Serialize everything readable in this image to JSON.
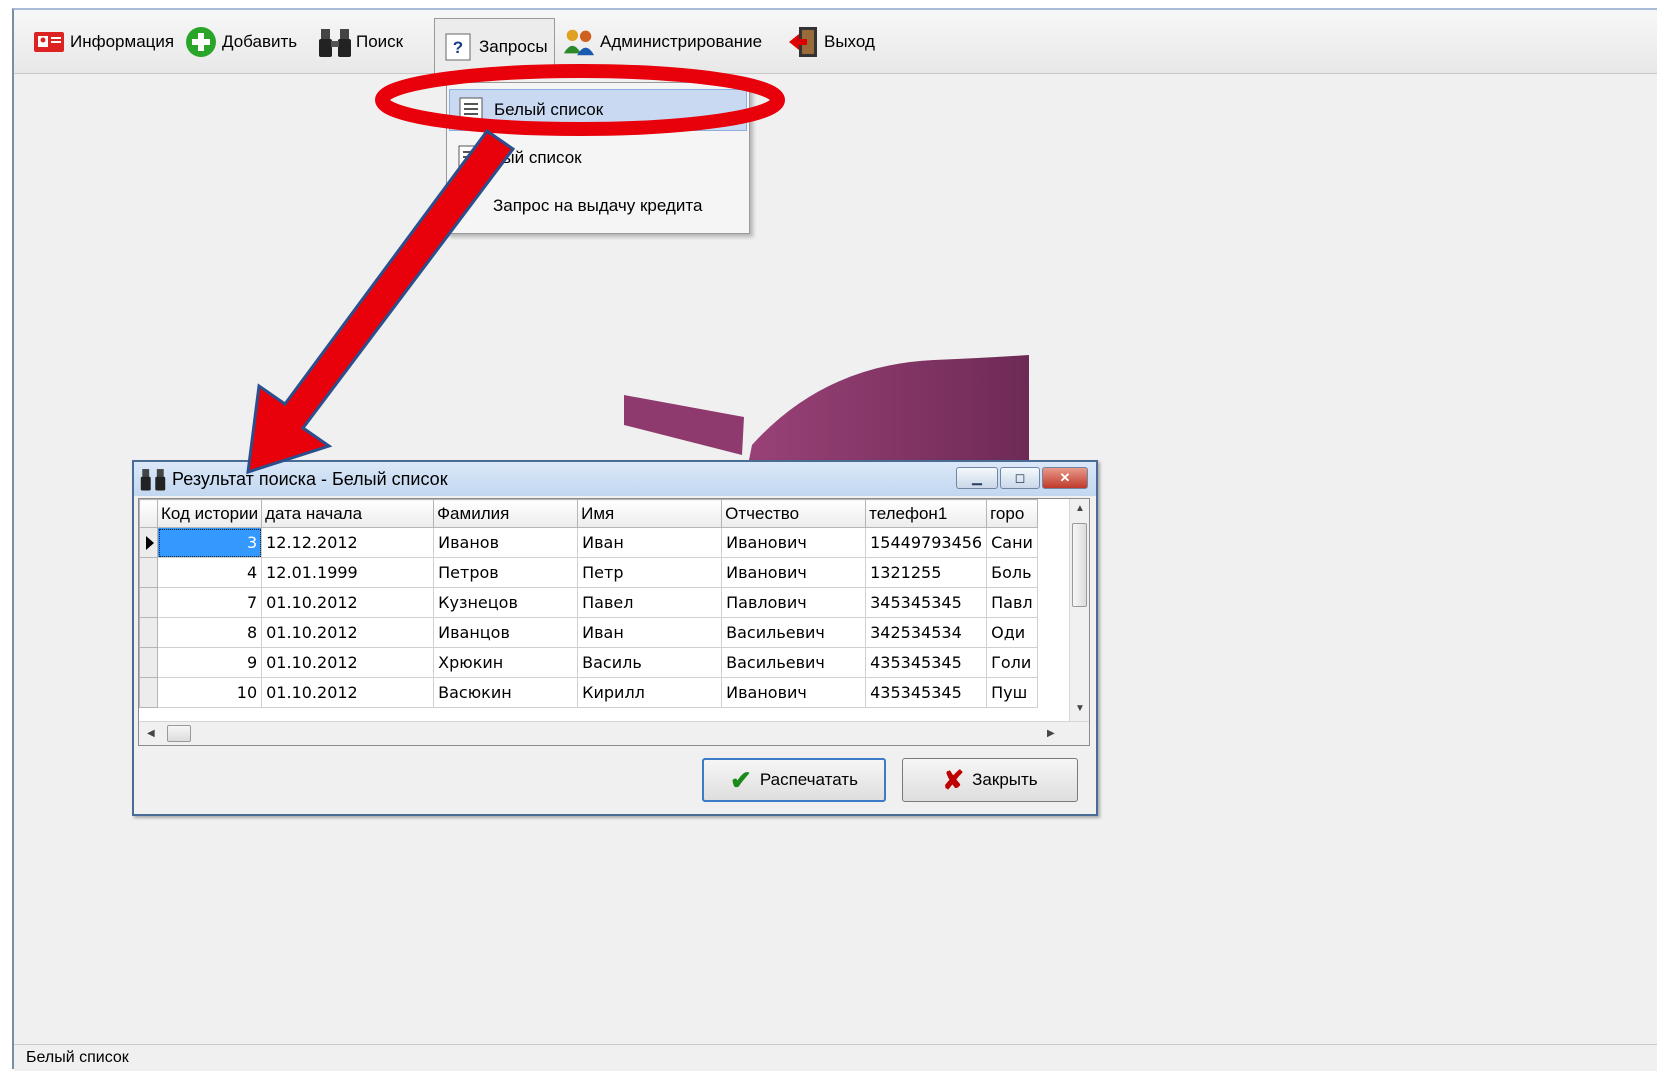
{
  "toolbar": {
    "info_label": "Информация",
    "add_label": "Добавить",
    "search_label": "Поиск",
    "queries_label": "Запросы",
    "admin_label": "Администрирование",
    "exit_label": "Выход",
    "queries_icon_glyph": "?"
  },
  "menu": {
    "white_list_label": "Белый список",
    "black_list_label": "ный список",
    "credit_request_label": "Запрос на выдачу кредита"
  },
  "dialog": {
    "title": "Результат поиска - Белый список",
    "columns": [
      "Код истории",
      "дата начала",
      "Фамилия",
      "Имя",
      "Отчество",
      "телефон1",
      "горо"
    ],
    "rows": [
      [
        "3",
        "12.12.2012",
        "Иванов",
        "Иван",
        "Иванович",
        "15449793456",
        "Сани"
      ],
      [
        "4",
        "12.01.1999",
        "Петров",
        "Петр",
        "Иванович",
        "1321255",
        "Боль"
      ],
      [
        "7",
        "01.10.2012",
        "Кузнецов",
        "Павел",
        "Павлович",
        "345345345",
        "Павл"
      ],
      [
        "8",
        "01.10.2012",
        "Иванцов",
        "Иван",
        "Васильевич",
        "342534534",
        "Оди"
      ],
      [
        "9",
        "01.10.2012",
        "Хрюкин",
        "Василь",
        "Васильевич",
        "435345345",
        "Голи"
      ],
      [
        "10",
        "01.10.2012",
        "Васюкин",
        "Кирилл",
        "Иванович",
        "435345345",
        "Пуш"
      ]
    ],
    "print_label": "Распечатать",
    "close_label": "Закрыть",
    "print_icon_glyph": "✔",
    "close_icon_glyph": "✘"
  },
  "statusbar": {
    "text": "Белый список"
  },
  "colors": {
    "selection": "#3399ff",
    "menu_highlight": "#c9d9f2",
    "annotation_red": "#e8000b",
    "logo_purple": "#8e3a6e"
  },
  "icons": [
    "info-icon",
    "add-icon",
    "binoculars-icon",
    "help-icon",
    "users-icon",
    "exit-icon",
    "list-icon",
    "check-icon",
    "x-icon"
  ]
}
